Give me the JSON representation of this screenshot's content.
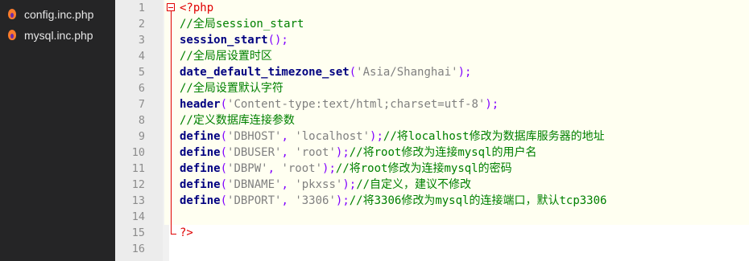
{
  "sidebar": {
    "files": [
      {
        "name": "config.inc.php",
        "icon": "php-file-icon"
      },
      {
        "name": "mysql.inc.php",
        "icon": "php-file-icon"
      }
    ]
  },
  "editor": {
    "line_numbers": [
      "1",
      "2",
      "3",
      "4",
      "5",
      "6",
      "7",
      "8",
      "9",
      "10",
      "11",
      "12",
      "13",
      "14",
      "15",
      "16"
    ],
    "lines": [
      [
        {
          "t": "<?php",
          "c": "ph"
        }
      ],
      [
        {
          "t": "//全局session_start",
          "c": "cm"
        }
      ],
      [
        {
          "t": "session_start",
          "c": "kw"
        },
        {
          "t": "();",
          "c": "pn"
        }
      ],
      [
        {
          "t": "//全局居设置时区",
          "c": "cm"
        }
      ],
      [
        {
          "t": "date_default_timezone_set",
          "c": "kw"
        },
        {
          "t": "(",
          "c": "pn"
        },
        {
          "t": "'Asia/Shanghai'",
          "c": "st"
        },
        {
          "t": ");",
          "c": "pn"
        }
      ],
      [
        {
          "t": "//全局设置默认字符",
          "c": "cm"
        }
      ],
      [
        {
          "t": "header",
          "c": "kw"
        },
        {
          "t": "(",
          "c": "pn"
        },
        {
          "t": "'Content-type:text/html;charset=utf-8'",
          "c": "st"
        },
        {
          "t": ");",
          "c": "pn"
        }
      ],
      [
        {
          "t": "//定义数据库连接参数",
          "c": "cm"
        }
      ],
      [
        {
          "t": "define",
          "c": "kw"
        },
        {
          "t": "(",
          "c": "pn"
        },
        {
          "t": "'DBHOST'",
          "c": "st"
        },
        {
          "t": ", ",
          "c": "pn"
        },
        {
          "t": "'localhost'",
          "c": "st"
        },
        {
          "t": ");",
          "c": "pn"
        },
        {
          "t": "//将localhost修改为数据库服务器的地址",
          "c": "cm"
        }
      ],
      [
        {
          "t": "define",
          "c": "kw"
        },
        {
          "t": "(",
          "c": "pn"
        },
        {
          "t": "'DBUSER'",
          "c": "st"
        },
        {
          "t": ", ",
          "c": "pn"
        },
        {
          "t": "'root'",
          "c": "st"
        },
        {
          "t": ");",
          "c": "pn"
        },
        {
          "t": "//将root修改为连接mysql的用户名",
          "c": "cm"
        }
      ],
      [
        {
          "t": "define",
          "c": "kw"
        },
        {
          "t": "(",
          "c": "pn"
        },
        {
          "t": "'DBPW'",
          "c": "st"
        },
        {
          "t": ", ",
          "c": "pn"
        },
        {
          "t": "'root'",
          "c": "st"
        },
        {
          "t": ");",
          "c": "pn"
        },
        {
          "t": "//将root修改为连接mysql的密码",
          "c": "cm"
        }
      ],
      [
        {
          "t": "define",
          "c": "kw"
        },
        {
          "t": "(",
          "c": "pn"
        },
        {
          "t": "'DBNAME'",
          "c": "st"
        },
        {
          "t": ", ",
          "c": "pn"
        },
        {
          "t": "'pkxss'",
          "c": "st"
        },
        {
          "t": ");",
          "c": "pn"
        },
        {
          "t": "//自定义，建议不修改",
          "c": "cm"
        }
      ],
      [
        {
          "t": "define",
          "c": "kw"
        },
        {
          "t": "(",
          "c": "pn"
        },
        {
          "t": "'DBPORT'",
          "c": "st"
        },
        {
          "t": ", ",
          "c": "pn"
        },
        {
          "t": "'3306'",
          "c": "st"
        },
        {
          "t": ");",
          "c": "pn"
        },
        {
          "t": "//将3306修改为mysql的连接端口，默认tcp3306",
          "c": "cm"
        }
      ],
      [],
      [
        {
          "t": "?>",
          "c": "ph"
        }
      ],
      []
    ]
  },
  "colors": {
    "sidebar_bg": "#252526",
    "gutter_bg": "#ececec",
    "keyword": "#000080",
    "comment": "#008000",
    "string": "#808080",
    "punctuation": "#8000ff",
    "php_tag": "#e00000"
  }
}
